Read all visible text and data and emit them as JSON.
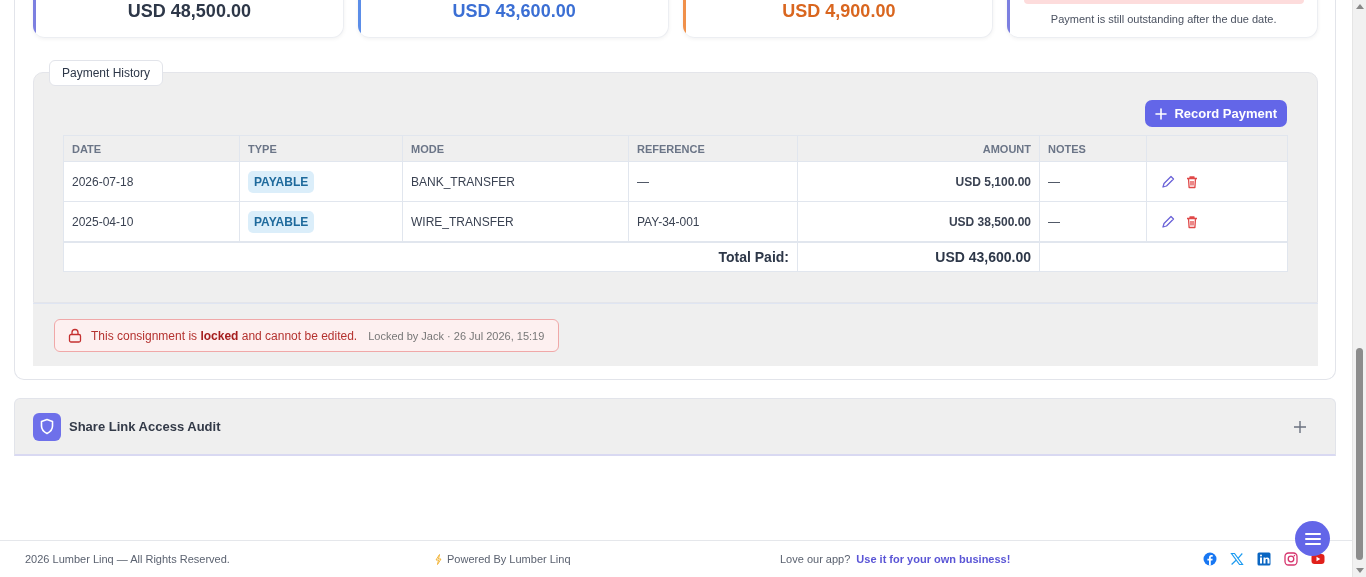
{
  "summary_cards": [
    {
      "kind": "total",
      "amount": "USD 48,500.00",
      "color": "#7c7fe0"
    },
    {
      "kind": "paid",
      "amount": "USD 43,600.00",
      "color": "#5b8de8"
    },
    {
      "kind": "due",
      "amount": "USD 4,900.00",
      "color": "#f0904a"
    },
    {
      "kind": "status",
      "note": "Payment is still outstanding after the due date.",
      "color": "#7c7fe0"
    }
  ],
  "payment_history": {
    "title": "Payment History",
    "record_button": "Record Payment",
    "columns": [
      {
        "label": "DATE",
        "kind": "text"
      },
      {
        "label": "TYPE",
        "kind": "text"
      },
      {
        "label": "MODE",
        "kind": "text"
      },
      {
        "label": "REFERENCE",
        "kind": "text"
      },
      {
        "label": "AMOUNT",
        "kind": "amount"
      },
      {
        "label": "NOTES",
        "kind": "text"
      }
    ],
    "rows": [
      {
        "date": "2026-07-18",
        "type": "PAYABLE",
        "mode": "BANK_TRANSFER",
        "reference": "—",
        "amount": "USD 5,100.00",
        "notes": "—"
      },
      {
        "date": "2025-04-10",
        "type": "PAYABLE",
        "mode": "WIRE_TRANSFER",
        "reference": "PAY-34-001",
        "amount": "USD 38,500.00",
        "notes": "—"
      }
    ],
    "total_label": "Total Paid:",
    "total_value": "USD 43,600.00"
  },
  "lock_notice": {
    "text": "This consignment is **locked** and cannot be edited.",
    "meta": "Locked by Jack · 26 Jul 2026, 15:19"
  },
  "audit": {
    "title": "Share Link Access Audit",
    "expanded": false
  },
  "footer": {
    "copyright": "2026 Lumber Linq — All Rights Reserved.",
    "powered": "Powered By Lumber Linq",
    "promo": "Love our app?",
    "promo_link": "Use it for your own business!"
  }
}
